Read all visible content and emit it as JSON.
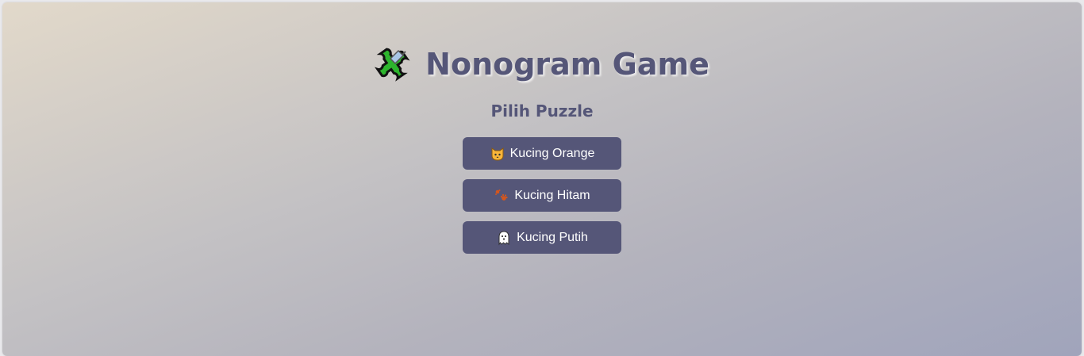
{
  "header": {
    "title": "Nonogram Game",
    "title_icon": "puzzle-piece-icon"
  },
  "menu": {
    "heading": "Pilih Puzzle",
    "items": [
      {
        "label": "Kucing Orange",
        "icon": "cat-face-icon"
      },
      {
        "label": "Kucing Hitam",
        "icon": "paw-prints-icon"
      },
      {
        "label": "Kucing Putih",
        "icon": "ghost-icon"
      }
    ]
  },
  "colors": {
    "accent": "#555678",
    "button_text": "#ffffff",
    "background_start": "#e2d9ca",
    "background_end": "#a0a4bb"
  }
}
